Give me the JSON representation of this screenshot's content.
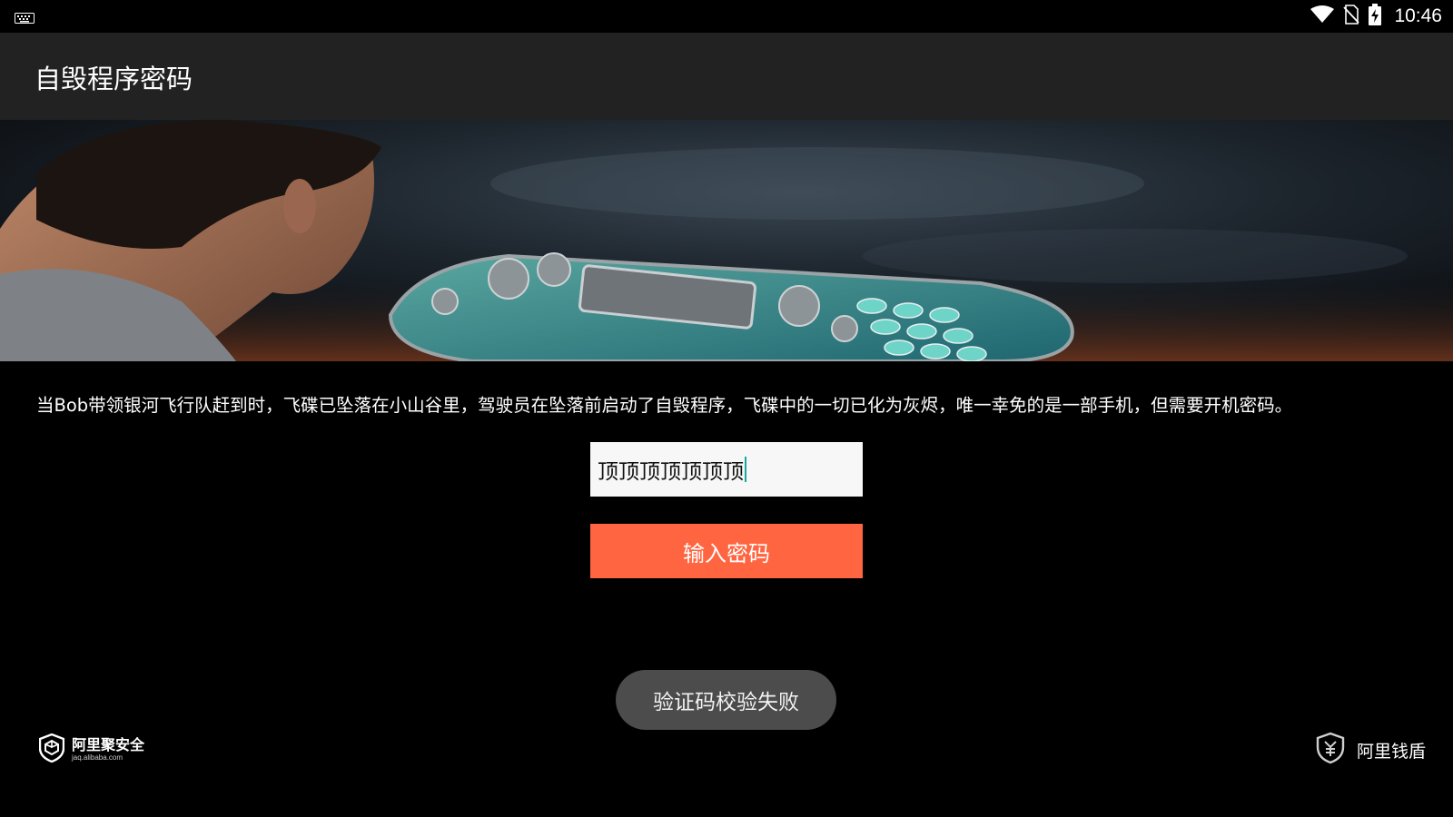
{
  "status_bar": {
    "time": "10:46",
    "icons": [
      "keyboard-icon",
      "wifi-icon",
      "no-sim-icon",
      "battery-charging-icon"
    ]
  },
  "app_bar": {
    "title": "自毁程序密码"
  },
  "banner": {
    "description_icon": "banner-image"
  },
  "story": {
    "text": "当Bob带领银河飞行队赶到时，飞碟已坠落在小山谷里，驾驶员在坠落前启动了自毁程序，飞碟中的一切已化为灰烬，唯一幸免的是一部手机，但需要开机密码。"
  },
  "password_input": {
    "value": "顶顶顶顶顶顶顶"
  },
  "submit_button": {
    "label": "输入密码"
  },
  "toast": {
    "message": "验证码校验失败"
  },
  "footer": {
    "left_brand": {
      "name": "阿里聚安全",
      "url": "jaq.alibaba.com"
    },
    "right_brand": {
      "name": "阿里钱盾"
    }
  },
  "colors": {
    "app_bar": "#222222",
    "background": "#000000",
    "button": "#ff6540",
    "toast": "#4c4c4c",
    "input_bg": "#f7f7f7"
  }
}
